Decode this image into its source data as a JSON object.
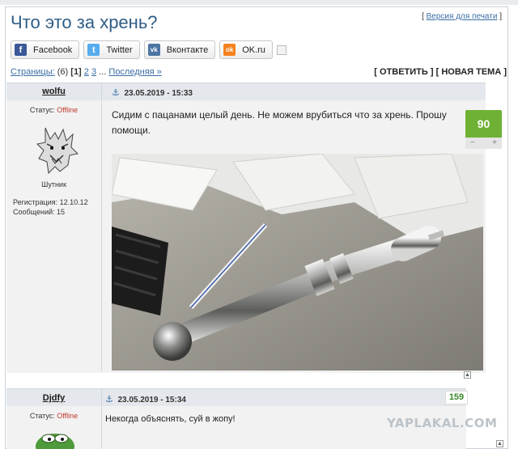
{
  "topic": {
    "title": "Что это за хрень?",
    "print_link": "Версия для печати"
  },
  "share": [
    {
      "label": "Facebook",
      "icon": "facebook-icon",
      "glyph": "f",
      "color": "#3b5998"
    },
    {
      "label": "Twitter",
      "icon": "twitter-icon",
      "glyph": "t",
      "color": "#55acee"
    },
    {
      "label": "Вконтакте",
      "icon": "vk-icon",
      "glyph": "vk",
      "color": "#4c75a3"
    },
    {
      "label": "OK.ru",
      "icon": "ok-icon",
      "glyph": "ok",
      "color": "#f58220"
    }
  ],
  "pagination": {
    "label": "Страницы:",
    "count": "(6)",
    "current": "[1]",
    "p2": "2",
    "p3": "3",
    "ellipsis": "...",
    "last": "Последняя »"
  },
  "actions": {
    "reply": "[ ОТВЕТИТЬ ]",
    "new_topic": "[ НОВАЯ ТЕМА ]"
  },
  "post1": {
    "author": "wolfu",
    "date": "23.05.2019 - 15:33",
    "status_label": "Статус:",
    "status_value": "Offline",
    "rank": "Шутник",
    "reg_label": "Регистрация: 12.10.12",
    "msgs_label": "Сообщений: 15",
    "text": "Сидим с пацанами целый день. Не можем врубиться что за хрень. Прошу помощи.",
    "rating": "90",
    "minus": "−",
    "plus": "+"
  },
  "post2": {
    "author": "Djdfy",
    "date": "23.05.2019 - 15:34",
    "status_label": "Статус:",
    "status_value": "Offline",
    "text": "Некогда объяснять, суй в жопу!",
    "rating": "159"
  },
  "watermark": "YAPLAKAL.COM",
  "colors": {
    "title": "#2f5d86",
    "link": "#3a6ea5",
    "rating_green": "#6fb134",
    "offline_red": "#c0392b"
  }
}
